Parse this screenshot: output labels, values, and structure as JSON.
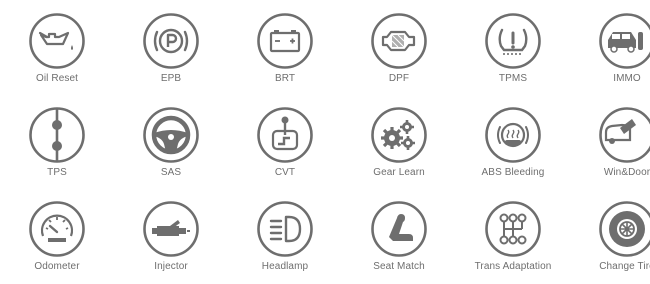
{
  "functions": [
    {
      "id": "oil-reset",
      "label": "Oil Reset",
      "icon": "oil-can-icon"
    },
    {
      "id": "epb",
      "label": "EPB",
      "icon": "parking-brake-icon"
    },
    {
      "id": "brt",
      "label": "BRT",
      "icon": "battery-icon"
    },
    {
      "id": "dpf",
      "label": "DPF",
      "icon": "particulate-filter-icon"
    },
    {
      "id": "tpms",
      "label": "TPMS",
      "icon": "tire-pressure-icon"
    },
    {
      "id": "immo",
      "label": "IMMO",
      "icon": "immobilizer-icon"
    },
    {
      "id": "tps",
      "label": "TPS",
      "icon": "throttle-position-icon"
    },
    {
      "id": "sas",
      "label": "SAS",
      "icon": "steering-wheel-icon"
    },
    {
      "id": "cvt",
      "label": "CVT",
      "icon": "gear-shift-icon"
    },
    {
      "id": "gear-learn",
      "label": "Gear Learn",
      "icon": "gears-icon"
    },
    {
      "id": "abs-bleeding",
      "label": "ABS Bleeding",
      "icon": "abs-icon"
    },
    {
      "id": "win-door",
      "label": "Win&Door",
      "icon": "car-door-icon"
    },
    {
      "id": "odometer",
      "label": "Odometer",
      "icon": "odometer-icon"
    },
    {
      "id": "injector",
      "label": "Injector",
      "icon": "injector-icon"
    },
    {
      "id": "headlamp",
      "label": "Headlamp",
      "icon": "headlamp-icon"
    },
    {
      "id": "seat-match",
      "label": "Seat Match",
      "icon": "seat-icon"
    },
    {
      "id": "trans-adaptation",
      "label": "Trans Adaptation",
      "icon": "transmission-icon"
    },
    {
      "id": "change-tire",
      "label": "Change Tire",
      "icon": "tire-icon"
    }
  ],
  "theme": {
    "icon_color": "#6e6e6e",
    "label_color": "#6e6e6e",
    "background": "#ffffff"
  }
}
